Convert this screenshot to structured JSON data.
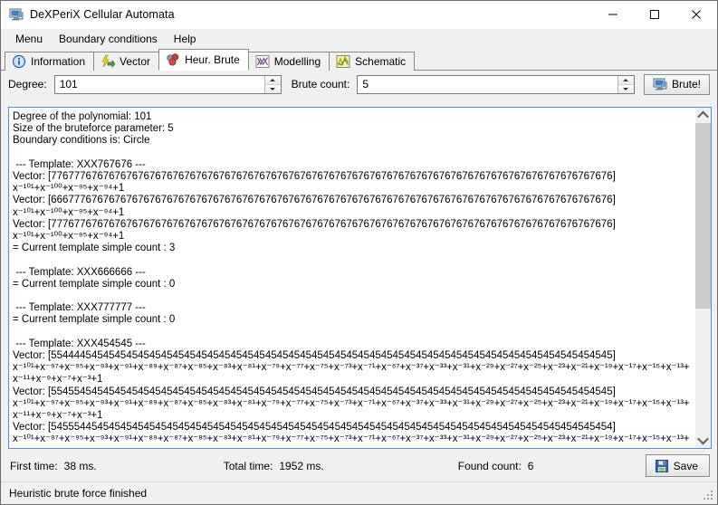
{
  "window": {
    "title": "DeXPeriX Cellular Automata",
    "icon": "monitor-icon",
    "minimize": "—",
    "maximize": "☐",
    "close": "✕"
  },
  "menubar": {
    "items": [
      {
        "label": "Menu",
        "name": "menu-item-menu"
      },
      {
        "label": "Boundary conditions",
        "name": "menu-item-boundary-conditions"
      },
      {
        "label": "Help",
        "name": "menu-item-help"
      }
    ]
  },
  "tabs": [
    {
      "label": "Information",
      "icon": "info-icon",
      "active": false
    },
    {
      "label": "Vector",
      "icon": "lightning-arrow-icon",
      "active": false
    },
    {
      "label": "Heur. Brute",
      "icon": "blocks-icon",
      "active": true
    },
    {
      "label": "Modelling",
      "icon": "chart-icon",
      "active": false
    },
    {
      "label": "Schematic",
      "icon": "schematic-icon",
      "active": false
    }
  ],
  "toolbar": {
    "degree_label": "Degree:",
    "degree_value": "101",
    "brute_count_label": "Brute count:",
    "brute_count_value": "5",
    "brute_button_label": "Brute!",
    "brute_button_icon": "monitor-icon"
  },
  "output": {
    "header": [
      "Degree of the polynomial: 101",
      "Size of the bruteforce parameter: 5",
      "Boundary conditions is: Circle"
    ],
    "blocks": [
      {
        "template": " --- Template: XXX767676 ---",
        "entries": [
          {
            "vector": "Vector: [7767776767676767676767676767676767676767676767676767676767676767676767676767676767676767676767676]",
            "poly": "x⁻¹⁰¹+x⁻¹⁰⁰+x⁻⁹⁵+x⁻⁹⁴+1"
          },
          {
            "vector": "Vector: [6667776767676767676767676767676767676767676767676767676767676767676767676767676767676767676767676]",
            "poly": "x⁻¹⁰¹+x⁻¹⁰⁰+x⁻⁹⁵+x⁻⁹⁴+1"
          },
          {
            "vector": "Vector: [7776776767676767676767676767676767676767676767676767676767676767676767676767676767676767676767676]",
            "poly": "x⁻¹⁰¹+x⁻¹⁰⁰+x⁻⁹⁵+x⁻⁹⁴+1"
          }
        ],
        "count_line": "= Current template simple count : 3"
      },
      {
        "template": " --- Template: XXX666666 ---",
        "entries": [],
        "count_line": "= Current template simple count : 0"
      },
      {
        "template": " --- Template: XXX777777 ---",
        "entries": [],
        "count_line": "= Current template simple count : 0"
      },
      {
        "template": " --- Template: XXX454545 ---",
        "entries": [
          {
            "vector": "Vector: [5544445454545454545454545454545454545454545454545454545454545454545454545454545454545454545454545]",
            "poly": "x⁻¹⁰¹+x⁻⁹⁷+x⁻⁹⁵+x⁻⁹³+x⁻⁹¹+x⁻⁸⁹+x⁻⁸⁷+x⁻⁸⁵+x⁻⁸³+x⁻⁸¹+x⁻⁷⁹+x⁻⁷⁷+x⁻⁷⁵+x⁻⁷³+x⁻⁷¹+x⁻⁶⁷+x⁻³⁷+x⁻³³+x⁻³¹+x⁻²⁹+x⁻²⁷+x⁻²⁵+x⁻²³+x⁻²¹+x⁻¹⁹+x⁻¹⁷+x⁻¹⁵+x⁻¹³+",
            "poly2": "x⁻¹¹+x⁻⁹+x⁻⁷+x⁻³+1"
          },
          {
            "vector": "Vector: [5545545454545454545454545454545454545454545454545454545454545454545454545454545454545454545454545]",
            "poly": "x⁻¹⁰¹+x⁻⁹⁷+x⁻⁹⁵+x⁻⁹³+x⁻⁹¹+x⁻⁸⁹+x⁻⁸⁷+x⁻⁸⁵+x⁻⁸³+x⁻⁸¹+x⁻⁷⁹+x⁻⁷⁷+x⁻⁷⁵+x⁻⁷³+x⁻⁷¹+x⁻⁶⁷+x⁻³⁷+x⁻³³+x⁻³¹+x⁻²⁹+x⁻²⁷+x⁻²⁵+x⁻²³+x⁻²¹+x⁻¹⁹+x⁻¹⁷+x⁻¹⁵+x⁻¹³+",
            "poly2": "x⁻¹¹+x⁻⁹+x⁻⁷+x⁻³+1"
          },
          {
            "vector": "Vector: [5455544545454545454545454545454545454545454545454545454545454545454545454545454545454545454545454]",
            "poly": "x⁻¹⁰¹+x⁻⁹⁷+x⁻⁹⁵+x⁻⁹³+x⁻⁹¹+x⁻⁸⁹+x⁻⁸⁷+x⁻⁸⁵+x⁻⁸³+x⁻⁸¹+x⁻⁷⁹+x⁻⁷⁷+x⁻⁷⁵+x⁻⁷³+x⁻⁷¹+x⁻⁶⁷+x⁻³⁷+x⁻³³+x⁻³¹+x⁻²⁹+x⁻²⁷+x⁻²⁵+x⁻²³+x⁻²¹+x⁻¹⁹+x⁻¹⁷+x⁻¹⁵+x⁻¹³+",
            "poly2": ""
          }
        ],
        "count_line": ""
      }
    ]
  },
  "scrollbar": {
    "up_arrow": "chevron-up",
    "down_arrow": "chevron-down",
    "thumb_fraction": 60
  },
  "footer": {
    "first_time_label": "First time:",
    "first_time_value": "38 ms.",
    "total_time_label": "Total time:",
    "total_time_value": "1952 ms.",
    "found_count_label": "Found count:",
    "found_count_value": "6",
    "save_label": "Save",
    "save_icon": "floppy-disk-icon"
  },
  "statusbar": {
    "text": "Heuristic brute force finished"
  },
  "colors": {
    "window_bg": "#f0f0f0",
    "text_area_border": "#4d90d9",
    "accent": "#4d90d9"
  }
}
